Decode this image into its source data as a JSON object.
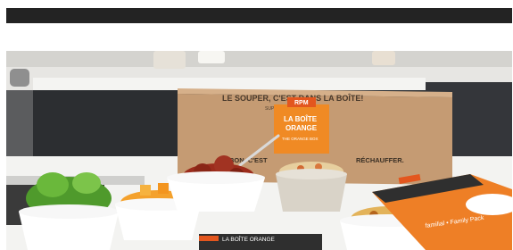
{
  "header": {
    "bar_color": "#232323"
  },
  "hero": {
    "box": {
      "top_text": "LE SOUPER, C'EST DANS LA BOÎTE!",
      "sub_text": "SUPPER IS IN THE BOX!",
      "label_line1": "LA BOÎTE",
      "label_line2": "ORANGE",
      "label_line3": "THE ORANGE BOX",
      "side_text_left": "BON. C'EST",
      "side_text_right": "RÉCHAUFFER.",
      "logo_text": "RPM"
    },
    "pack": {
      "subtitle": "familial • Family Pack"
    },
    "card": {
      "title": "LA BOÎTE ORANGE"
    },
    "colors": {
      "orange": "#f08a24",
      "kraft": "#c9a07a",
      "counter": "#f2f2f0"
    }
  }
}
